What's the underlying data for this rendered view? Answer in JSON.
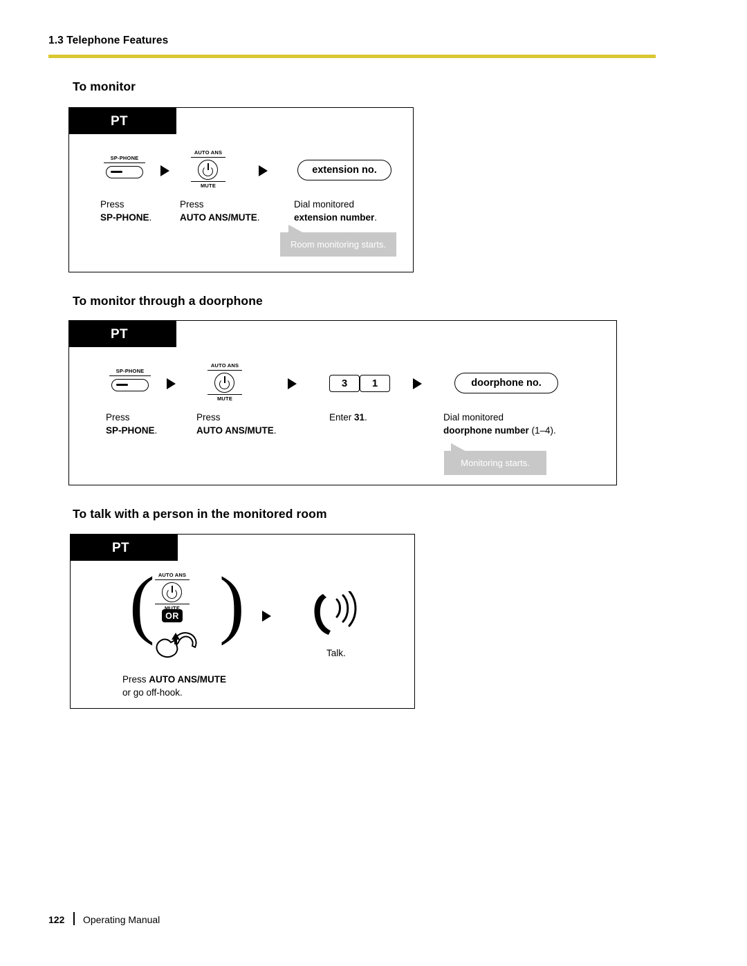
{
  "header": {
    "section_label": "1.3 Telephone Features",
    "rule_color": "#d9c832"
  },
  "sections": [
    {
      "title": "To monitor",
      "box_label": "PT",
      "steps": [
        {
          "icon": "sp-phone-key",
          "key_label": "SP-PHONE",
          "caption_line1": "Press",
          "caption_line2_bold": "SP-PHONE",
          "caption_line2_tail": "."
        },
        {
          "icon": "auto-ans-mute-key",
          "key_label_top": "AUTO ANS",
          "key_label_bottom": "MUTE",
          "caption_line1": "Press",
          "caption_line2_bold": "AUTO ANS/MUTE",
          "caption_line2_tail": "."
        },
        {
          "icon": "field-box",
          "field_text": "extension no.",
          "caption_line1": "Dial monitored",
          "caption_line2_bold": "extension number",
          "caption_line2_tail": "."
        }
      ],
      "bubble": "Room monitoring starts."
    },
    {
      "title": "To monitor through a doorphone",
      "box_label": "PT",
      "steps": [
        {
          "icon": "sp-phone-key",
          "key_label": "SP-PHONE",
          "caption_line1": "Press",
          "caption_line2_bold": "SP-PHONE",
          "caption_line2_tail": "."
        },
        {
          "icon": "auto-ans-mute-key",
          "key_label_top": "AUTO ANS",
          "key_label_bottom": "MUTE",
          "caption_line1": "Press",
          "caption_line2_bold": "AUTO ANS/MUTE",
          "caption_line2_tail": "."
        },
        {
          "icon": "digit-keys",
          "digits": [
            "3",
            "1"
          ],
          "caption_line1": "Enter ",
          "caption_line1_bold": "31",
          "caption_line1_tail": "."
        },
        {
          "icon": "field-box",
          "field_text": "doorphone no.",
          "caption_line1": "Dial monitored",
          "caption_line2_bold": "doorphone number",
          "caption_line2_tail": " (1–4)."
        }
      ],
      "bubble": "Monitoring starts."
    },
    {
      "title": "To talk with a person in the monitored room",
      "box_label": "PT",
      "steps": [
        {
          "icon": "auto-ans-mute-or-handset",
          "key_label_top": "AUTO ANS",
          "key_label_bottom": "MUTE",
          "or_label": "OR",
          "caption_line1": "Press ",
          "caption_line1_bold": "AUTO ANS/MUTE",
          "caption_line2": "or go off-hook."
        },
        {
          "icon": "handset-talking",
          "caption_line1": "Talk."
        }
      ]
    }
  ],
  "footer": {
    "page_number": "122",
    "manual_title": "Operating Manual"
  }
}
